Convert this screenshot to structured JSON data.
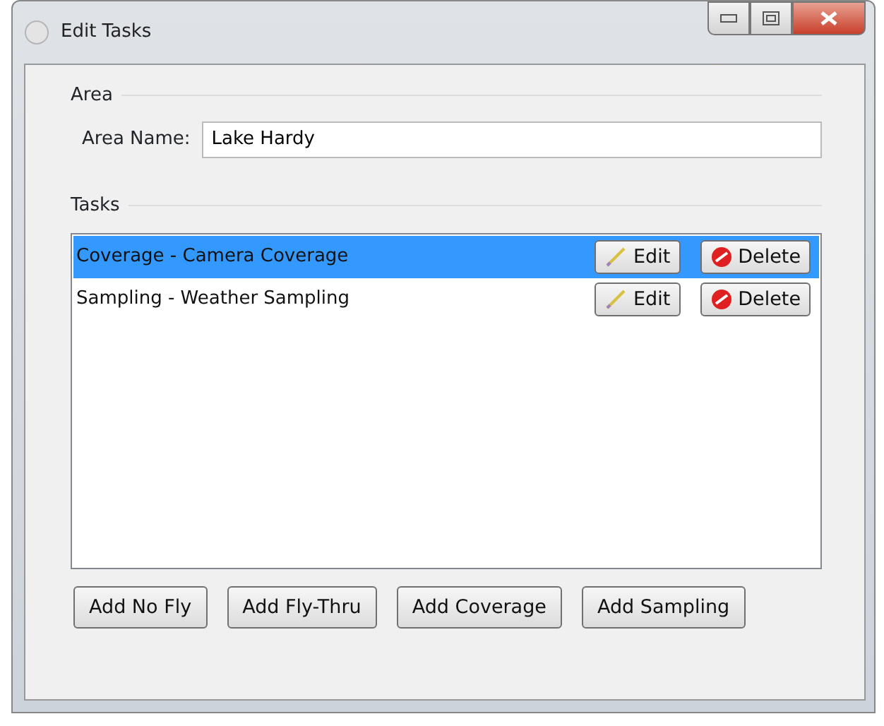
{
  "window": {
    "title": "Edit Tasks"
  },
  "area": {
    "heading": "Area",
    "name_label": "Area Name:",
    "name_value": "Lake Hardy"
  },
  "tasks": {
    "heading": "Tasks",
    "rows": [
      {
        "label": "Coverage - Camera Coverage",
        "selected": true,
        "edit": "Edit",
        "delete": "Delete"
      },
      {
        "label": "Sampling - Weather Sampling",
        "selected": false,
        "edit": "Edit",
        "delete": "Delete"
      }
    ]
  },
  "buttons": [
    "Add No Fly",
    "Add Fly-Thru",
    "Add Coverage",
    "Add Sampling"
  ]
}
